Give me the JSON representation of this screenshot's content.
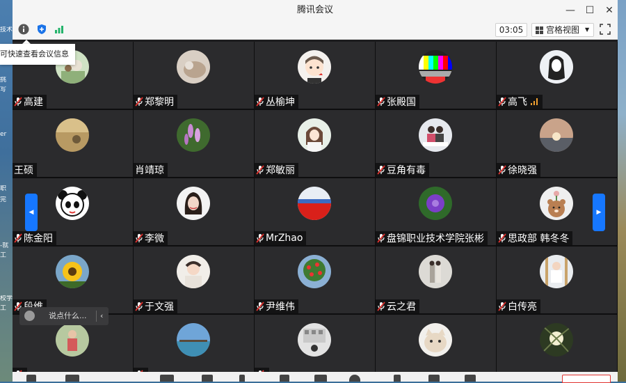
{
  "window": {
    "title": "腾讯会议"
  },
  "window_controls": {
    "minimize": "—",
    "maximize": "☐",
    "close": "✕"
  },
  "toolbar": {
    "timer": "03:05",
    "view_label": "宫格视图",
    "view_caret": "▼",
    "info_tooltip": "可快速查看会议信息"
  },
  "desktop_left_labels": [
    "技术",
    "挑",
    "写",
    "er",
    "职",
    "完",
    "-就",
    "工",
    "校学",
    "工"
  ],
  "participants": [
    {
      "name": "高建",
      "mic": true,
      "avatar": "photo-family"
    },
    {
      "name": "郑黎明",
      "mic": true,
      "avatar": "photo-cat"
    },
    {
      "name": "丛榆坤",
      "mic": true,
      "avatar": "cartoon-boy"
    },
    {
      "name": "张殿国",
      "mic": true,
      "avatar": "tv-test-pattern"
    },
    {
      "name": "高飞",
      "mic": true,
      "avatar": "sketch-girl",
      "signal": true
    },
    {
      "name": "王硕",
      "mic": false,
      "avatar": "photo-field"
    },
    {
      "name": "肖靖琼",
      "mic": false,
      "avatar": "photo-flowers"
    },
    {
      "name": "郑敏丽",
      "mic": true,
      "avatar": "illustration-girl"
    },
    {
      "name": "豆角有毒",
      "mic": true,
      "avatar": "photo-couple"
    },
    {
      "name": "徐晓强",
      "mic": true,
      "avatar": "photo-sunset"
    },
    {
      "name": "陈金阳",
      "mic": true,
      "avatar": "panda-cartoon"
    },
    {
      "name": "李微",
      "mic": true,
      "avatar": "photo-woman"
    },
    {
      "name": "MrZhao",
      "mic": true,
      "avatar": "photo-red-field"
    },
    {
      "name": "盘锦职业技术学院张彬",
      "mic": true,
      "avatar": "photo-purple-flower"
    },
    {
      "name": "思政部 韩冬冬",
      "mic": true,
      "avatar": "bear-cartoon"
    },
    {
      "name": "段维",
      "mic": true,
      "avatar": "photo-sunflower"
    },
    {
      "name": "于文强",
      "mic": true,
      "avatar": "photo-baby"
    },
    {
      "name": "尹维伟",
      "mic": true,
      "avatar": "photo-fruit-tree"
    },
    {
      "name": "云之君",
      "mic": true,
      "avatar": "photo-street-couple"
    },
    {
      "name": "白传亮",
      "mic": true,
      "avatar": "photo-child"
    },
    {
      "name": "",
      "mic": true,
      "avatar": "photo-child-outdoor"
    },
    {
      "name": "",
      "mic": true,
      "avatar": "photo-pier"
    },
    {
      "name": "",
      "mic": true,
      "avatar": "photo-building"
    },
    {
      "name": "",
      "mic": false,
      "avatar": "photo-kitten"
    },
    {
      "name": "",
      "mic": false,
      "avatar": "photo-tree-light"
    }
  ],
  "nav": {
    "prev": "◀",
    "next": "▶"
  },
  "chat": {
    "placeholder": "说点什么...",
    "collapse": "‹"
  },
  "colors": {
    "accent": "#1677ff",
    "muted_mic": "#e0322f",
    "signal": "#f0a030",
    "security_shield": "#1a73e8",
    "network_good": "#24b36b"
  }
}
